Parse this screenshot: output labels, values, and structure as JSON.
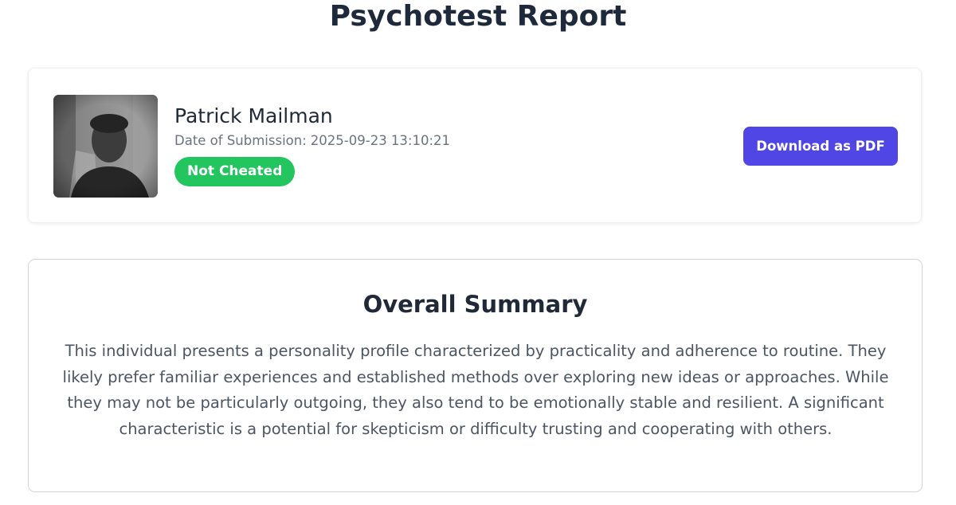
{
  "page": {
    "title": "Psychotest Report"
  },
  "profile": {
    "name": "Patrick Mailman",
    "date_label": "Date of Submission:",
    "date_value": "2025-09-23 13:10:21",
    "status": "Not Cheated",
    "status_color": "#22c55e",
    "download_label": "Download as PDF",
    "accent_color": "#4f46e5"
  },
  "summary": {
    "title": "Overall Summary",
    "text": "This individual presents a personality profile characterized by practicality and adherence to routine. They likely prefer familiar experiences and established methods over exploring new ideas or approaches. While they may not be particularly outgoing, they also tend to be emotionally stable and resilient. A significant characteristic is a potential for skepticism or difficulty trusting and cooperating with others."
  }
}
